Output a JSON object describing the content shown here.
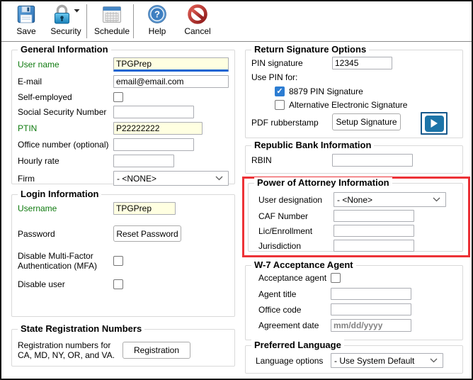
{
  "toolbar": {
    "buttons": [
      {
        "label": "Save",
        "icon": "floppy-disk-icon"
      },
      {
        "label": "Security",
        "icon": "padlock-icon",
        "has_dropdown": true
      },
      {
        "label": "Schedule",
        "icon": "calendar-icon"
      },
      {
        "label": "Help",
        "icon": "help-icon"
      },
      {
        "label": "Cancel",
        "icon": "prohibition-icon"
      }
    ]
  },
  "general_information": {
    "title": "General Information",
    "user_name": {
      "label": "User name",
      "value": "TPGPrep",
      "focused": true
    },
    "email": {
      "label": "E-mail",
      "value": "email@email.com"
    },
    "self_employed": {
      "label": "Self-employed",
      "checked": false
    },
    "ssn": {
      "label": "Social Security Number",
      "value": ""
    },
    "ptin": {
      "label": "PTIN",
      "value": "P22222222"
    },
    "office_number": {
      "label": "Office number (optional)",
      "value": ""
    },
    "hourly_rate": {
      "label": "Hourly rate",
      "value": ""
    },
    "firm": {
      "label": "Firm",
      "selected": "- <NONE>"
    }
  },
  "login_information": {
    "title": "Login Information",
    "username": {
      "label": "Username",
      "value": "TPGPrep"
    },
    "password": {
      "label": "Password",
      "button": "Reset Password"
    },
    "mfa": {
      "label": "Disable Multi-Factor Authentication (MFA)",
      "checked": false
    },
    "disable_user": {
      "label": "Disable user",
      "checked": false
    }
  },
  "state_registration": {
    "title": "State Registration Numbers",
    "description": "Registration numbers for CA, MD, NY, OR, and VA.",
    "button": "Registration"
  },
  "return_signature": {
    "title": "Return Signature Options",
    "pin_signature": {
      "label": "PIN signature",
      "value": "12345"
    },
    "use_pin_for": "Use PIN for:",
    "pin_8879": {
      "label": "8879 PIN Signature",
      "checked": true
    },
    "alt_electronic": {
      "label": "Alternative Electronic Signature",
      "checked": false
    },
    "pdf_rubberstamp": {
      "label": "PDF rubberstamp",
      "button": "Setup Signature"
    }
  },
  "republic_bank": {
    "title": "Republic Bank Information",
    "rbin": {
      "label": "RBIN",
      "value": ""
    }
  },
  "power_of_attorney": {
    "title": "Power of Attorney Information",
    "highlighted": true,
    "user_designation": {
      "label": "User designation",
      "selected": "- <None>"
    },
    "caf_number": {
      "label": "CAF Number",
      "value": ""
    },
    "lic_enrollment": {
      "label": "Lic/Enrollment",
      "value": ""
    },
    "jurisdiction": {
      "label": "Jurisdiction",
      "value": ""
    }
  },
  "w7_acceptance": {
    "title": "W-7 Acceptance Agent",
    "acceptance_agent": {
      "label": "Acceptance agent",
      "checked": false
    },
    "agent_title": {
      "label": "Agent title",
      "value": ""
    },
    "office_code": {
      "label": "Office code",
      "value": ""
    },
    "agreement_date": {
      "label": "Agreement date",
      "value": "",
      "placeholder": "mm/dd/yyyy"
    }
  },
  "preferred_language": {
    "title": "Preferred Language",
    "language_options": {
      "label": "Language options",
      "selected": "- Use System Default"
    }
  },
  "colors": {
    "label_green": "#0E7A0E",
    "field_yellow": "#FFFFE1",
    "focus_blue": "#1464D2",
    "checkbox_blue": "#2D7DD2",
    "highlight_red": "#ED3237",
    "play_button_blue": "#1C74A8"
  }
}
